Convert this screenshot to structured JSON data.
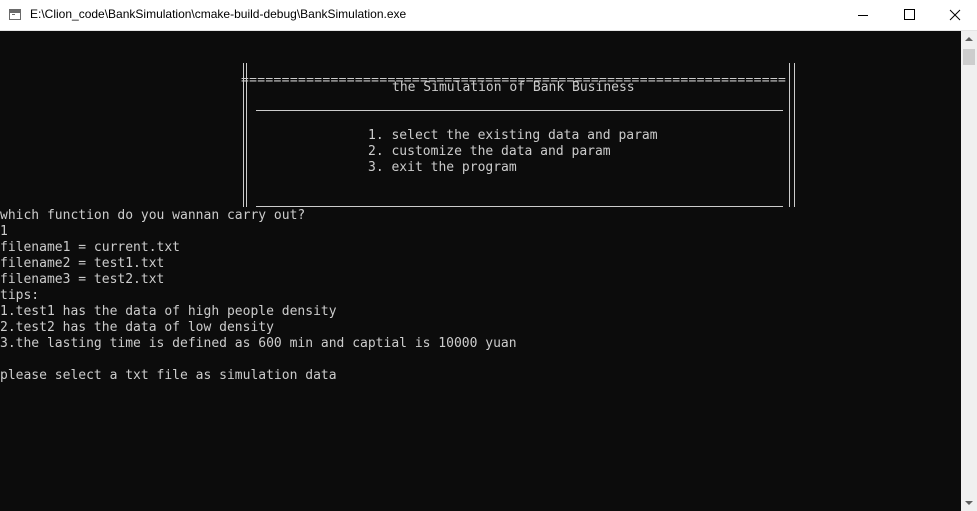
{
  "window": {
    "title": "E:\\Clion_code\\BankSimulation\\cmake-build-debug\\BankSimulation.exe",
    "minimize_icon": "minimize-icon",
    "maximize_icon": "maximize-icon",
    "close_icon": "close-icon"
  },
  "menu": {
    "border": "===================================================================",
    "heading": "the Simulation of Bank Business",
    "options": [
      "1. select the existing data and param",
      "2. customize the data and param",
      "3. exit the program"
    ]
  },
  "output": [
    "which function do you wannan carry out?",
    "1",
    "filename1 = current.txt",
    "filename2 = test1.txt",
    "filename3 = test2.txt",
    "tips:",
    "1.test1 has the data of high people density",
    "2.test2 has the data of low density",
    "3.the lasting time is defined as 600 min and captial is 10000 yuan",
    "",
    "please select a txt file as simulation data"
  ],
  "colors": {
    "console_bg": "#0c0c0c",
    "console_text": "#cccccc",
    "titlebar_bg": "#ffffff"
  }
}
